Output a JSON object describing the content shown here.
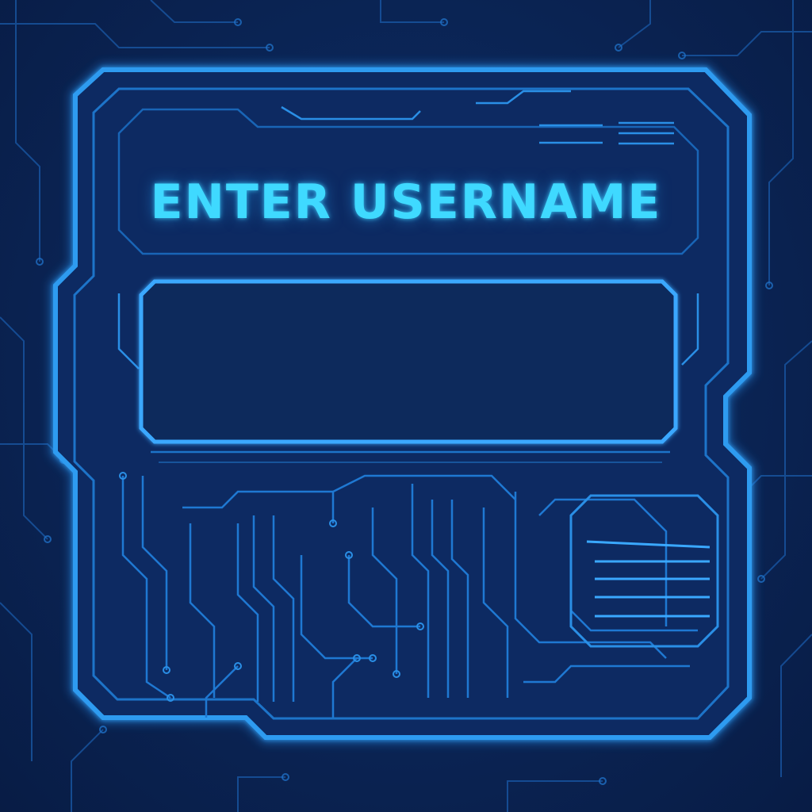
{
  "form": {
    "title": "ENTER USERNAME",
    "username_value": ""
  },
  "theme": {
    "background": "#0b2658",
    "frame_outline": "#1f8fe0",
    "accent_glow": "#3fd9ff",
    "input_fill": "#0b2a5c"
  },
  "decor": {
    "style": "circuit-board-traces",
    "panel": "chamfered-frame"
  }
}
